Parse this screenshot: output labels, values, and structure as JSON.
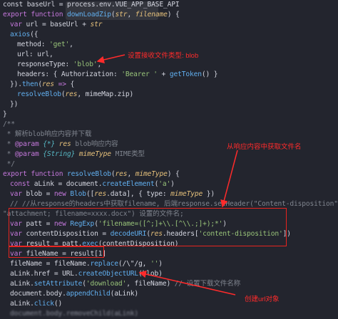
{
  "code": {
    "l1": {
      "a": "const baseUrl = process.env.VUE_APP_BASE_API"
    },
    "l2": {
      "kw": "export function ",
      "fn": "downLoadZip",
      "p1": "(",
      "a1": "str",
      "p2": ", ",
      "a2": "filename",
      "p3": ") {"
    },
    "l3": {
      "kw": "var ",
      "a": "url = baseUrl + ",
      "b": "str"
    },
    "l4": {
      "fn": "axios",
      "a": "({"
    },
    "l5": {
      "a": "method: ",
      "s": "'get'",
      "b": ","
    },
    "l6": {
      "a": "url: url,"
    },
    "l7": {
      "a": "responseType: ",
      "s": "'blob'",
      "b": ","
    },
    "l8": {
      "a": "headers: { Authorization: ",
      "s": "'Bearer '",
      "b": " + ",
      "fn": "getToken",
      "c": "() }"
    },
    "l9": {
      "a": "}).",
      "fn": "then",
      "b": "(",
      "p": "res",
      "kw": " =>",
      "c": " {"
    },
    "l10": {
      "fn": "resolveBlob",
      "a": "(",
      "p": "res",
      "b": ", mimeMap.zip)"
    },
    "l11": {
      "a": "})"
    },
    "l12": {
      "a": "}"
    },
    "l13": {
      "a": "/**"
    },
    "l14": {
      "a": " * 解析blob响应内容并下载"
    },
    "l15": {
      "a": " * ",
      "k": "@param",
      "t": " {*}",
      "p": " res",
      "b": " blob响应内容"
    },
    "l16": {
      "a": " * ",
      "k": "@param",
      "t": " {String}",
      "p": " mimeType",
      "b": " MIME类型"
    },
    "l17": {
      "a": " */"
    },
    "l18": {
      "kw": "export function ",
      "fn": "resolveBlob",
      "a": "(",
      "p1": "res",
      "b": ", ",
      "p2": "mimeType",
      "c": ") {"
    },
    "l19": {
      "kw": "const ",
      "a": "aLink = document.",
      "fn": "createElement",
      "b": "(",
      "s": "'a'",
      "c": ")"
    },
    "l20": {
      "kw": "var ",
      "a": "blob = ",
      "kw2": "new ",
      "fn": "Blob",
      "b": "([",
      "p1": "res",
      "c": ".data], { type: ",
      "p2": "mimeType",
      "d": " })"
    },
    "l21": {
      "a": "// //从response的headers中获取filename, 后端response.setHeader(\"Content-disposition\","
    },
    "l22": {
      "a": "\"attachment; filename=xxxx.docx\") 设置的文件名;"
    },
    "l23": {
      "kw": "var ",
      "a": "patt = ",
      "kw2": "new ",
      "fn": "RegExp",
      "b": "(",
      "s": "'filename=([^;]+\\\\.[^\\\\.;]+);*'",
      "c": ")"
    },
    "l24": {
      "kw": "var ",
      "a": "contentDisposition = ",
      "fn": "decodeURI",
      "b": "(",
      "p": "res",
      "c": ".headers[",
      "s": "'content-disposition'",
      "d": "])"
    },
    "l25": {
      "kw": "var ",
      "a": "result = patt.",
      "fn": "exec",
      "b": "(contentDisposition)"
    },
    "l26": {
      "kw": "var ",
      "a": "fileName = result[1]"
    },
    "l27": {
      "a": "fileName = fileName.",
      "fn": "replace",
      "b": "(/\\\"/g, ",
      "s": "''",
      "c": ")"
    },
    "l28": {
      "a": "aLink.href = URL.",
      "fn": "createObjectURL",
      "b": "(blob)"
    },
    "l29": {
      "a": "aLink.",
      "fn": "setAttribute",
      "b": "(",
      "s": "'download'",
      "c": ", fileName) ",
      "cm": "// 设置下载文件名称"
    },
    "l30": {
      "a": "document.body.",
      "fn": "appendChild",
      "b": "(aLink)"
    },
    "l31": {
      "a": "aLink.",
      "fn": "click",
      "b": "()"
    },
    "l32": {
      "a": "document.body.removeChild(aLink)"
    }
  },
  "annotations": {
    "response_type": "设置接收文件类型: blob",
    "get_filename": "从响应内容中获取文件名",
    "create_url": "创建url对象"
  }
}
